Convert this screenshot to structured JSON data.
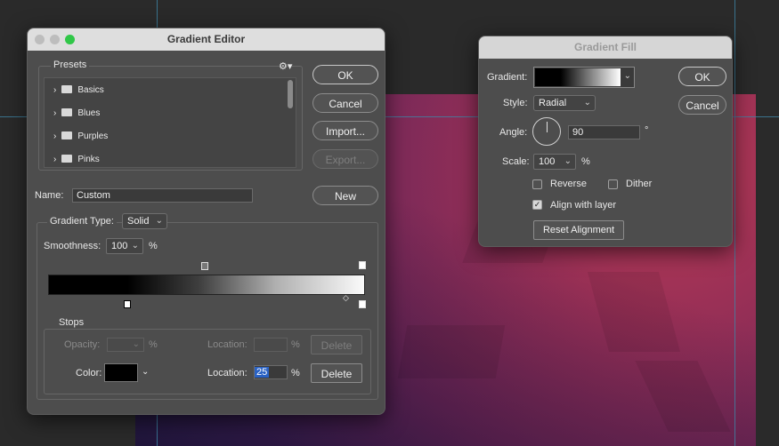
{
  "gradient_editor": {
    "title": "Gradient Editor",
    "presets_label": "Presets",
    "presets": [
      "Basics",
      "Blues",
      "Purples",
      "Pinks"
    ],
    "buttons": {
      "ok": "OK",
      "cancel": "Cancel",
      "import": "Import...",
      "export": "Export...",
      "new": "New"
    },
    "name_label": "Name:",
    "name_value": "Custom",
    "gradient_type_label": "Gradient Type:",
    "gradient_type_value": "Solid",
    "smoothness_label": "Smoothness:",
    "smoothness_value": "100",
    "percent": "%",
    "stops": {
      "label": "Stops",
      "opacity_label": "Opacity:",
      "location_label": "Location:",
      "delete_label": "Delete",
      "color_label": "Color:",
      "color_location_value": "25"
    }
  },
  "gradient_fill": {
    "title": "Gradient Fill",
    "gradient_label": "Gradient:",
    "style_label": "Style:",
    "style_value": "Radial",
    "angle_label": "Angle:",
    "angle_value": "90",
    "degree_symbol": "°",
    "scale_label": "Scale:",
    "scale_value": "100",
    "percent": "%",
    "reverse_label": "Reverse",
    "dither_label": "Dither",
    "align_label": "Align with layer",
    "reset_label": "Reset Alignment",
    "ok": "OK",
    "cancel": "Cancel",
    "reverse_checked": false,
    "dither_checked": false,
    "align_checked": true
  }
}
